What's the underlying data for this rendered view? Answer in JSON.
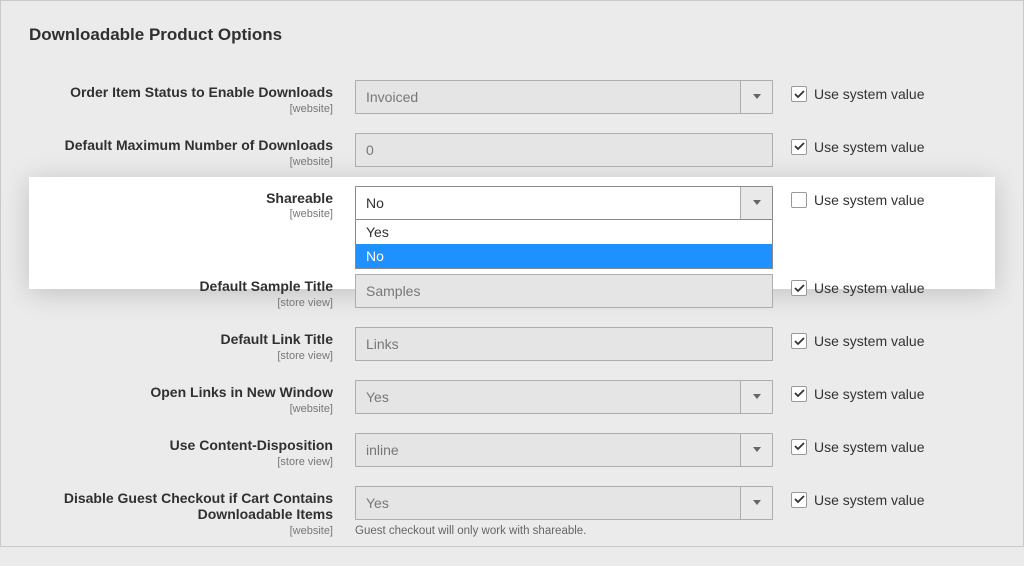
{
  "section_title": "Downloadable Product Options",
  "use_system_value_label": "Use system value",
  "scopes": {
    "website": "[website]",
    "store_view": "[store view]"
  },
  "rows": {
    "order_status": {
      "label": "Order Item Status to Enable Downloads",
      "scope": "[website]",
      "value": "Invoiced",
      "use_system": true
    },
    "max_downloads": {
      "label": "Default Maximum Number of Downloads",
      "scope": "[website]",
      "value": "0",
      "use_system": true
    },
    "shareable": {
      "label": "Shareable",
      "scope": "[website]",
      "value": "No",
      "use_system": false,
      "options": [
        "Yes",
        "No"
      ],
      "highlighted_option": "No"
    },
    "sample_title": {
      "label": "Default Sample Title",
      "scope": "[store view]",
      "value": "Samples",
      "use_system": true
    },
    "link_title": {
      "label": "Default Link Title",
      "scope": "[store view]",
      "value": "Links",
      "use_system": true
    },
    "new_window": {
      "label": "Open Links in New Window",
      "scope": "[website]",
      "value": "Yes",
      "use_system": true
    },
    "content_disposition": {
      "label": "Use Content-Disposition",
      "scope": "[store view]",
      "value": "inline",
      "use_system": true
    },
    "disable_guest": {
      "label": "Disable Guest Checkout if Cart Contains Downloadable Items",
      "scope": "[website]",
      "value": "Yes",
      "use_system": true,
      "helper": "Guest checkout will only work with shareable."
    }
  }
}
